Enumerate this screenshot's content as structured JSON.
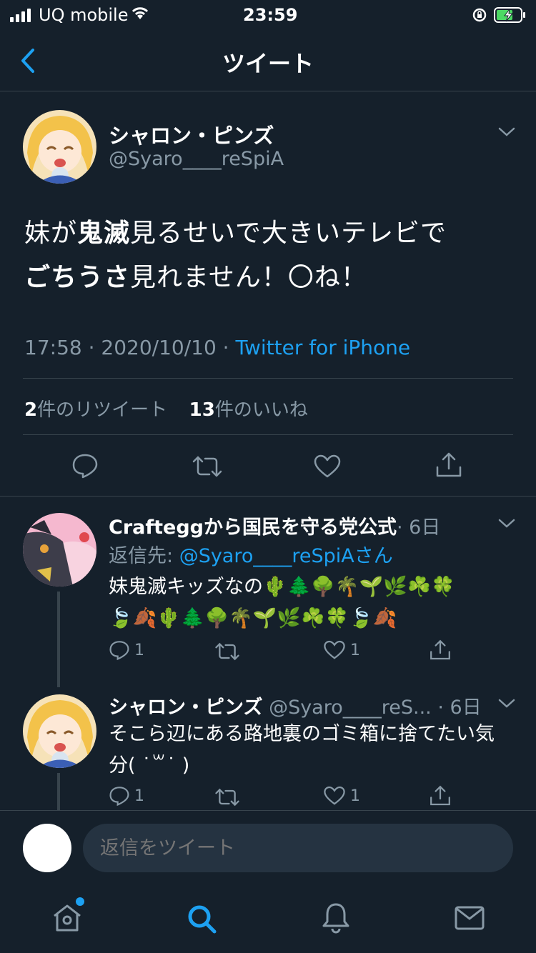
{
  "status_bar": {
    "carrier": "UQ mobile",
    "time": "23:59"
  },
  "nav": {
    "title": "ツイート"
  },
  "main_tweet": {
    "display_name": "シャロン・ピンズ",
    "handle": "@Syaro____reSpiA",
    "text_parts": [
      {
        "text": "妹が",
        "bold": false
      },
      {
        "text": "鬼滅",
        "bold": true
      },
      {
        "text": "見るせいで大きいテレビで",
        "bold": false
      },
      {
        "text": "ごちうさ",
        "bold": true
      },
      {
        "text": "見れません！〇ね！",
        "bold": false
      }
    ],
    "timestamp": "17:58 · 2020/10/10 · ",
    "source": "Twitter for iPhone",
    "retweet_count": "2",
    "retweet_label": "件のリツイート",
    "like_count": "13",
    "like_label": "件のいいね"
  },
  "replies": [
    {
      "display_name": "Crafteggから国民を守る党公式",
      "time": "· 6日",
      "reply_to_label": "返信先: ",
      "reply_to_handle": "@Syaro____reSpiAさん",
      "text_line1": "妹鬼滅キッズなの🌵🌲🌳🌴🌱🌿☘️🍀",
      "text_line2": "🍃🍂🌵🌲🌳🌴🌱🌿☘️🍀🍃🍂",
      "reply_count": "1",
      "like_count": "1"
    },
    {
      "display_name": "シャロン・ピンズ",
      "handle": "@Syaro____reS...",
      "time": "· 6日",
      "text_line1": "そこら辺にある路地裏のゴミ箱に捨てたい気",
      "text_line2": "分( ˙꒳˙ )",
      "reply_count": "1",
      "like_count": "1"
    }
  ],
  "composer": {
    "placeholder": "返信をツイート"
  },
  "tab_bar": {
    "items": [
      "home",
      "search",
      "notifications",
      "messages"
    ],
    "active": "search"
  },
  "colors": {
    "background": "#15202b",
    "accent": "#1da1f2",
    "muted": "#8899a6",
    "divider": "#38444d"
  }
}
